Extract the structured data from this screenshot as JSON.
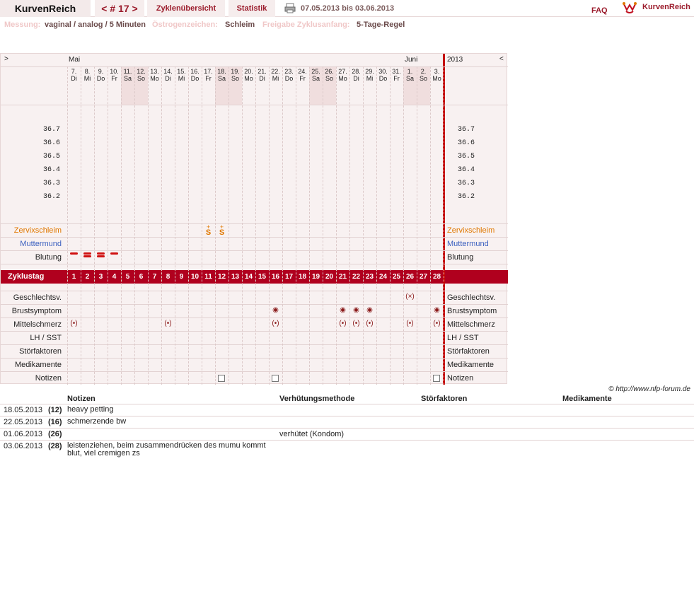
{
  "header": {
    "brand": "KurvenReich",
    "cycle_nav": "< # 17 >",
    "tab_overview": "Zyklenübersicht",
    "tab_stats": "Statistik",
    "date_range": "07.05.2013 bis 03.06.2013",
    "faq": "FAQ",
    "logo_text": "KurvenReich"
  },
  "meta": {
    "measure_label": "Messung:",
    "measure_value": "vaginal / analog / 5 Minuten",
    "estrogen_label": "Östrogenzeichen:",
    "estrogen_value": "Schleim",
    "release_label": "Freigabe Zyklusanfang:",
    "release_value": "5-Tage-Regel"
  },
  "chart": {
    "nav_left": ">",
    "nav_right": "<",
    "month_may": "Mai",
    "month_june": "Juni",
    "year": "2013",
    "days": [
      {
        "d": "7.",
        "w": "Di"
      },
      {
        "d": "8.",
        "w": "Mi"
      },
      {
        "d": "9.",
        "w": "Do"
      },
      {
        "d": "10.",
        "w": "Fr"
      },
      {
        "d": "11.",
        "w": "Sa"
      },
      {
        "d": "12.",
        "w": "So"
      },
      {
        "d": "13.",
        "w": "Mo"
      },
      {
        "d": "14.",
        "w": "Di"
      },
      {
        "d": "15.",
        "w": "Mi"
      },
      {
        "d": "16.",
        "w": "Do"
      },
      {
        "d": "17.",
        "w": "Fr"
      },
      {
        "d": "18.",
        "w": "Sa"
      },
      {
        "d": "19.",
        "w": "So"
      },
      {
        "d": "20.",
        "w": "Mo"
      },
      {
        "d": "21.",
        "w": "Di"
      },
      {
        "d": "22.",
        "w": "Mi"
      },
      {
        "d": "23.",
        "w": "Do"
      },
      {
        "d": "24.",
        "w": "Fr"
      },
      {
        "d": "25.",
        "w": "Sa"
      },
      {
        "d": "26.",
        "w": "So"
      },
      {
        "d": "27.",
        "w": "Mo"
      },
      {
        "d": "28.",
        "w": "Di"
      },
      {
        "d": "29.",
        "w": "Mi"
      },
      {
        "d": "30.",
        "w": "Do"
      },
      {
        "d": "31.",
        "w": "Fr"
      },
      {
        "d": "1.",
        "w": "Sa"
      },
      {
        "d": "2.",
        "w": "So"
      },
      {
        "d": "3.",
        "w": "Mo"
      }
    ],
    "weekend_days": [
      5,
      6,
      12,
      13,
      19,
      20,
      26,
      27
    ],
    "temps": [
      "36.7",
      "36.6",
      "36.5",
      "36.4",
      "36.3",
      "36.2"
    ],
    "rows": {
      "cervix": "Zervixschleim",
      "cervix_os": "Muttermund",
      "bleeding": "Blutung",
      "cycle_day": "Zyklustag",
      "intercourse": "Geschlechtsv.",
      "breast": "Brustsymptom",
      "midpain": "Mittelschmerz",
      "lh": "LH / SST",
      "disturb": "Störfaktoren",
      "meds": "Medikamente",
      "notes": "Notizen"
    },
    "mucus_symbol": "S",
    "mucus_days": [
      11,
      12
    ],
    "bleeding_days": [
      {
        "day": 1,
        "intensity": 1
      },
      {
        "day": 2,
        "intensity": 2
      },
      {
        "day": 3,
        "intensity": 2
      },
      {
        "day": 4,
        "intensity": 1
      }
    ],
    "intercourse_days": [
      26
    ],
    "breast_days": [
      16,
      21,
      22,
      23,
      28
    ],
    "midpain_days": [
      1,
      8,
      16,
      21,
      22,
      23,
      26,
      28
    ],
    "note_days": [
      12,
      16,
      28
    ],
    "marker_symbols": {
      "intercourse": "(×)",
      "breast": "◉",
      "midpain": "(•)"
    },
    "cycle_days": [
      1,
      2,
      3,
      4,
      5,
      6,
      7,
      8,
      9,
      10,
      11,
      12,
      13,
      14,
      15,
      16,
      17,
      18,
      19,
      20,
      21,
      22,
      23,
      24,
      25,
      26,
      27,
      28
    ]
  },
  "copyright": "© http://www.nfp-forum.de",
  "notes_table": {
    "headers": [
      "Notizen",
      "Verhütungsmethode",
      "Störfaktoren",
      "Medikamente"
    ],
    "rows": [
      {
        "date": "18.05.2013",
        "day": "(12)",
        "note": "heavy petting",
        "method": ""
      },
      {
        "date": "22.05.2013",
        "day": "(16)",
        "note": "schmerzende bw",
        "method": ""
      },
      {
        "date": "01.06.2013",
        "day": "(26)",
        "note": "",
        "method": "verhütet (Kondom)"
      },
      {
        "date": "03.06.2013",
        "day": "(28)",
        "note": "leistenziehen, beim zusammendrücken des mumu kommt blut, viel cremigen zs",
        "method": ""
      }
    ]
  },
  "colors": {
    "accent": "#9b1b2b",
    "bar": "#b0001e",
    "divider": "#c40000",
    "grid_bg": "#f8f1f1",
    "mucus": "#e07800",
    "os": "#3a5fbf"
  }
}
